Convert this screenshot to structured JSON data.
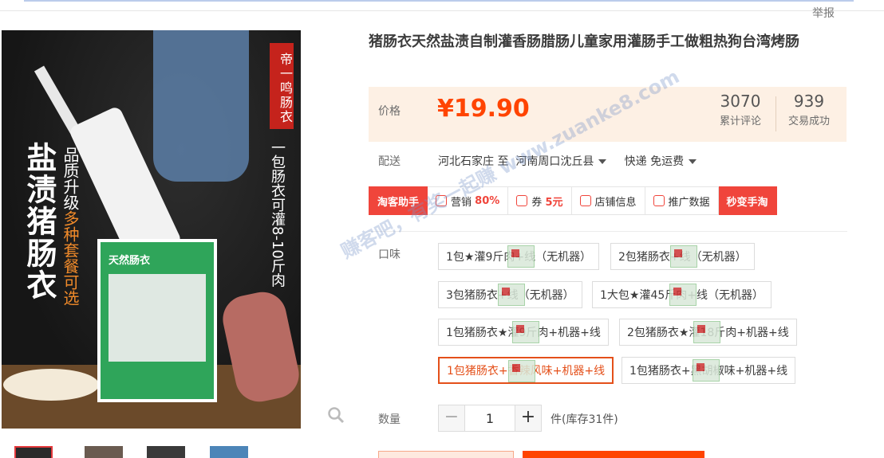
{
  "header": {
    "report_label": "举报"
  },
  "gallery": {
    "brand_text": "帝一鸣肠衣",
    "big_text": "盐渍猪肠衣",
    "mid_text_a": "品质升级",
    "mid_text_b": "多种套餐可选",
    "right_text": "一包肠衣可灌8-10斤肉",
    "package_text": "天然肠衣",
    "thumbnail_count": 4
  },
  "product": {
    "title": "猪肠衣天然盐渍自制灌香肠腊肠儿童家用灌肠手工做粗热狗台湾烤肠",
    "price_label": "价格",
    "price": "¥19.90",
    "reviews_count": "3070",
    "reviews_label": "累计评论",
    "sales_count": "939",
    "sales_label": "交易成功"
  },
  "shipping": {
    "label": "配送",
    "from": "河北石家庄",
    "to_word": "至",
    "destination": "河南周口沈丘县",
    "method": "快递 免运费"
  },
  "toolbar": {
    "assistant": "淘客助手",
    "marketing_label": "营销",
    "marketing_value": "80%",
    "coupon_label": "券",
    "coupon_value": "5元",
    "shop_info": "店铺信息",
    "promo_data": "推广数据",
    "switch": "秒变手淘"
  },
  "options": {
    "label": "口味",
    "items": [
      "1包★灌9斤肉+线（无机器）",
      "2包猪肠衣+线（无机器）",
      "3包猪肠衣+线（无机器）",
      "1大包★灌45斤肉+线（无机器）",
      "1包猪肠衣★灌9斤肉+机器+线",
      "2包猪肠衣★灌18斤肉+机器+线",
      "1包猪肠衣+香辣风味+机器+线",
      "1包猪肠衣+黑胡椒味+机器+线"
    ],
    "selected_index": 6
  },
  "quantity": {
    "label": "数量",
    "value": "1",
    "minus": "−",
    "plus": "+",
    "stock": "件(库存31件)"
  },
  "watermark": "赚客吧，有奖一起赚 www.zuanke8.com",
  "colors": {
    "price": "#ff4400",
    "accent_red": "#f0453b",
    "price_bg": "#fdf0e4"
  }
}
